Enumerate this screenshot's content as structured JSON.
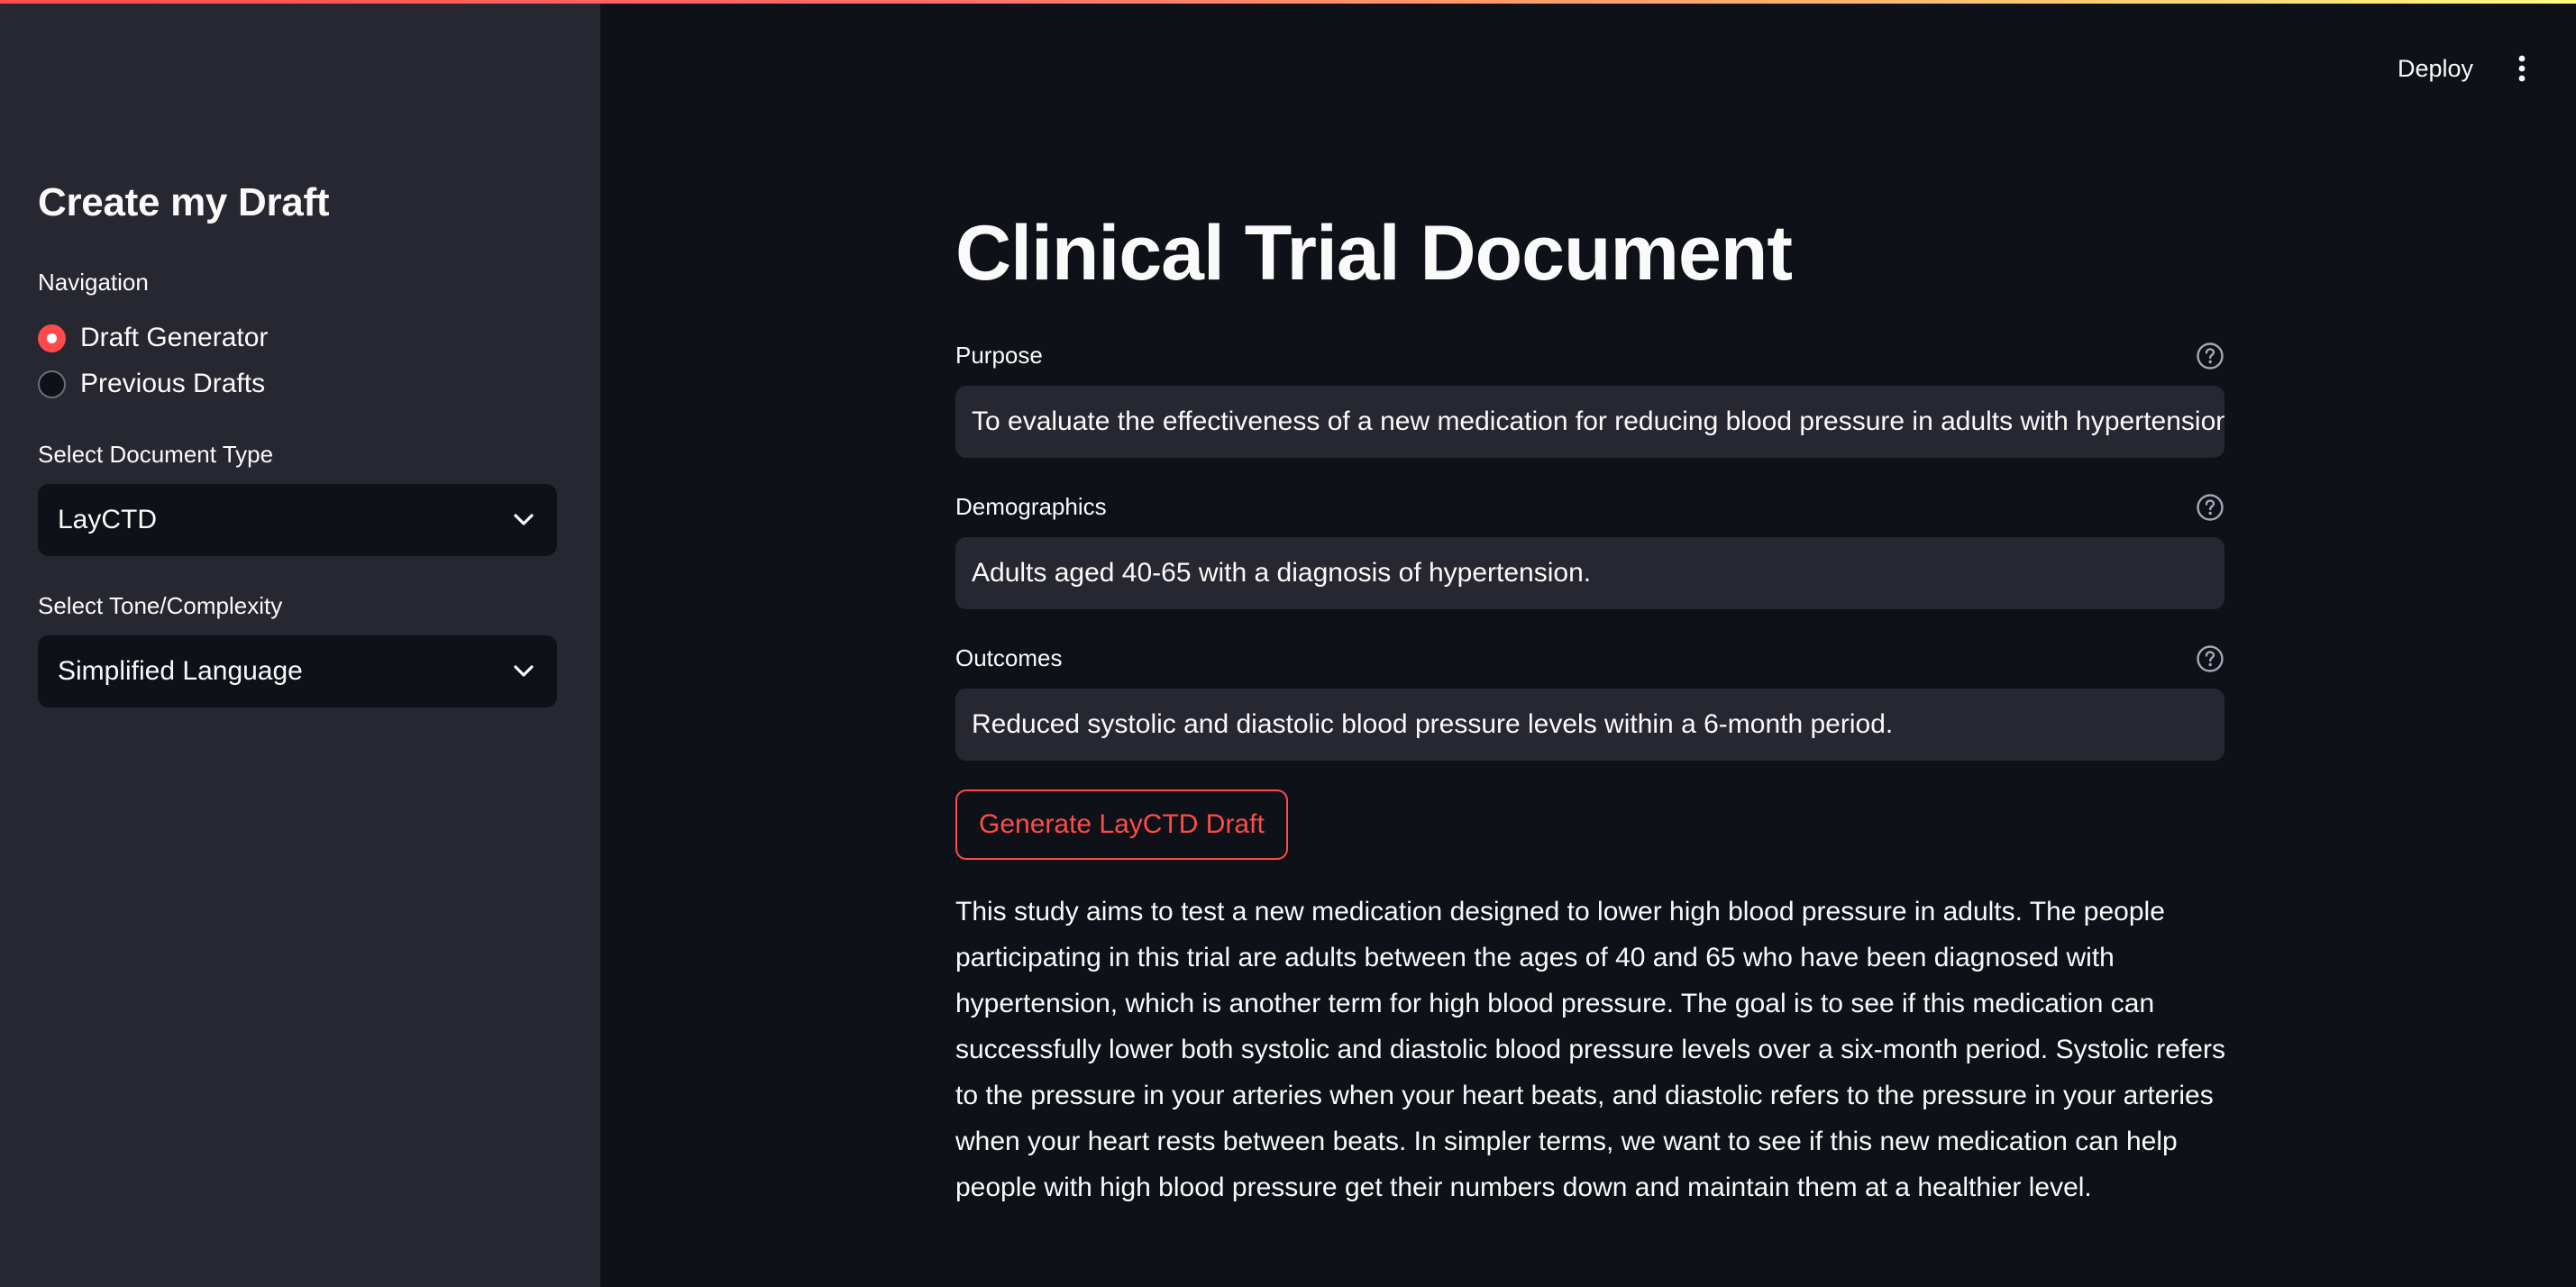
{
  "sidebar": {
    "title": "Create my Draft",
    "navigation": {
      "label": "Navigation",
      "options": [
        {
          "label": "Draft Generator",
          "selected": true
        },
        {
          "label": "Previous Drafts",
          "selected": false
        }
      ]
    },
    "document_type": {
      "label": "Select Document Type",
      "value": "LayCTD"
    },
    "tone": {
      "label": "Select Tone/Complexity",
      "value": "Simplified Language"
    }
  },
  "header": {
    "deploy_label": "Deploy",
    "menu_icon": "more-vertical-icon"
  },
  "main": {
    "title": "Clinical Trial Document",
    "fields": [
      {
        "label": "Purpose",
        "value": "To evaluate the effectiveness of a new medication for reducing blood pressure in adults with hypertension."
      },
      {
        "label": "Demographics",
        "value": "Adults aged 40-65 with a diagnosis of hypertension."
      },
      {
        "label": "Outcomes",
        "value": "Reduced systolic and diastolic blood pressure levels within a 6-month period."
      }
    ],
    "generate_label": "Generate LayCTD Draft",
    "output_text": "This study aims to test a new medication designed to lower high blood pressure in adults. The people participating in this trial are adults between the ages of 40 and 65 who have been diagnosed with hypertension, which is another term for high blood pressure. The goal is to see if this medication can successfully lower both systolic and diastolic blood pressure levels over a six-month period. Systolic refers to the pressure in your arteries when your heart beats, and diastolic refers to the pressure in your arteries when your heart rests between beats. In simpler terms, we want to see if this new medication can help people with high blood pressure get their numbers down and maintain them at a healthier level."
  },
  "colors": {
    "background": "#0e1117",
    "sidebar": "#262730",
    "accent": "#ff4b4b",
    "text": "#fafafa"
  }
}
